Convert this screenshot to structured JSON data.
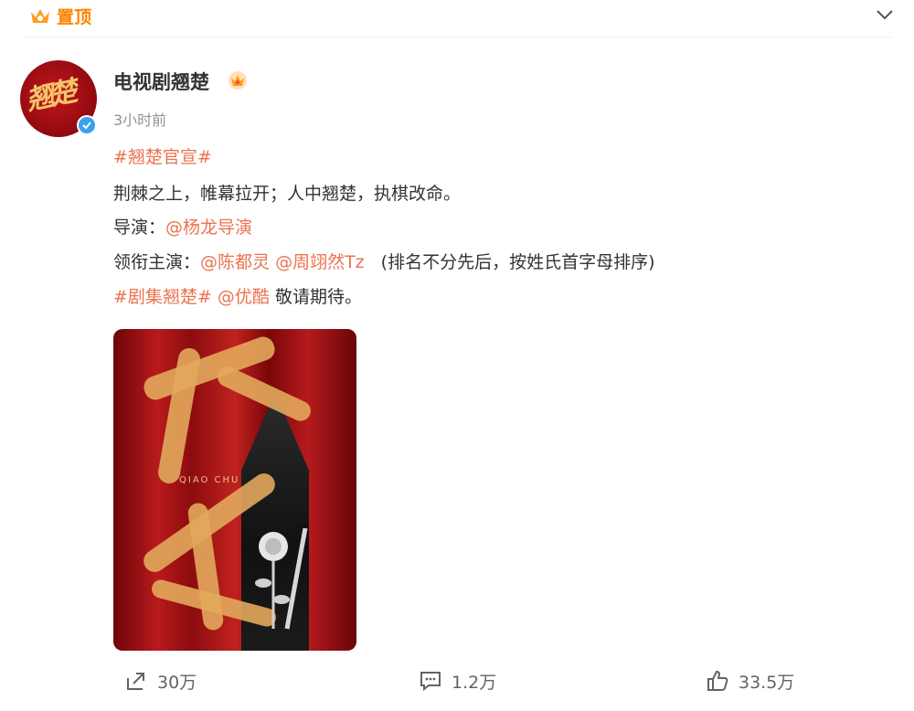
{
  "header": {
    "pin_label": "置顶"
  },
  "post": {
    "username": "电视剧翘楚",
    "time": "3小时前",
    "line1": {
      "hashtag": "#翘楚官宣#"
    },
    "line2": {
      "text": "荆棘之上，帷幕拉开；人中翘楚，执棋改命。"
    },
    "line3": {
      "prefix": "导演：",
      "mention": "@杨龙导演"
    },
    "line4": {
      "prefix": "领衔主演：",
      "mention1": "@陈都灵",
      "mention2": "@周翊然Tz",
      "note": "(排名不分先后，按姓氏首字母排序)"
    },
    "line5": {
      "hashtag": "#剧集翘楚#",
      "mention": "@优酷",
      "text": "敬请期待。"
    },
    "poster": {
      "title_art": "翘楚",
      "subtitle": "QIAO CHU"
    }
  },
  "avatar": {
    "art_text": "翘楚"
  },
  "actions": [
    {
      "icon": "share-icon",
      "label": "30万"
    },
    {
      "icon": "comment-icon",
      "label": "1.2万"
    },
    {
      "icon": "like-icon",
      "label": "33.5万"
    }
  ],
  "colors": {
    "accent_orange": "#ff8200",
    "link": "#eb7350",
    "verified_blue": "#3aa0ef"
  }
}
